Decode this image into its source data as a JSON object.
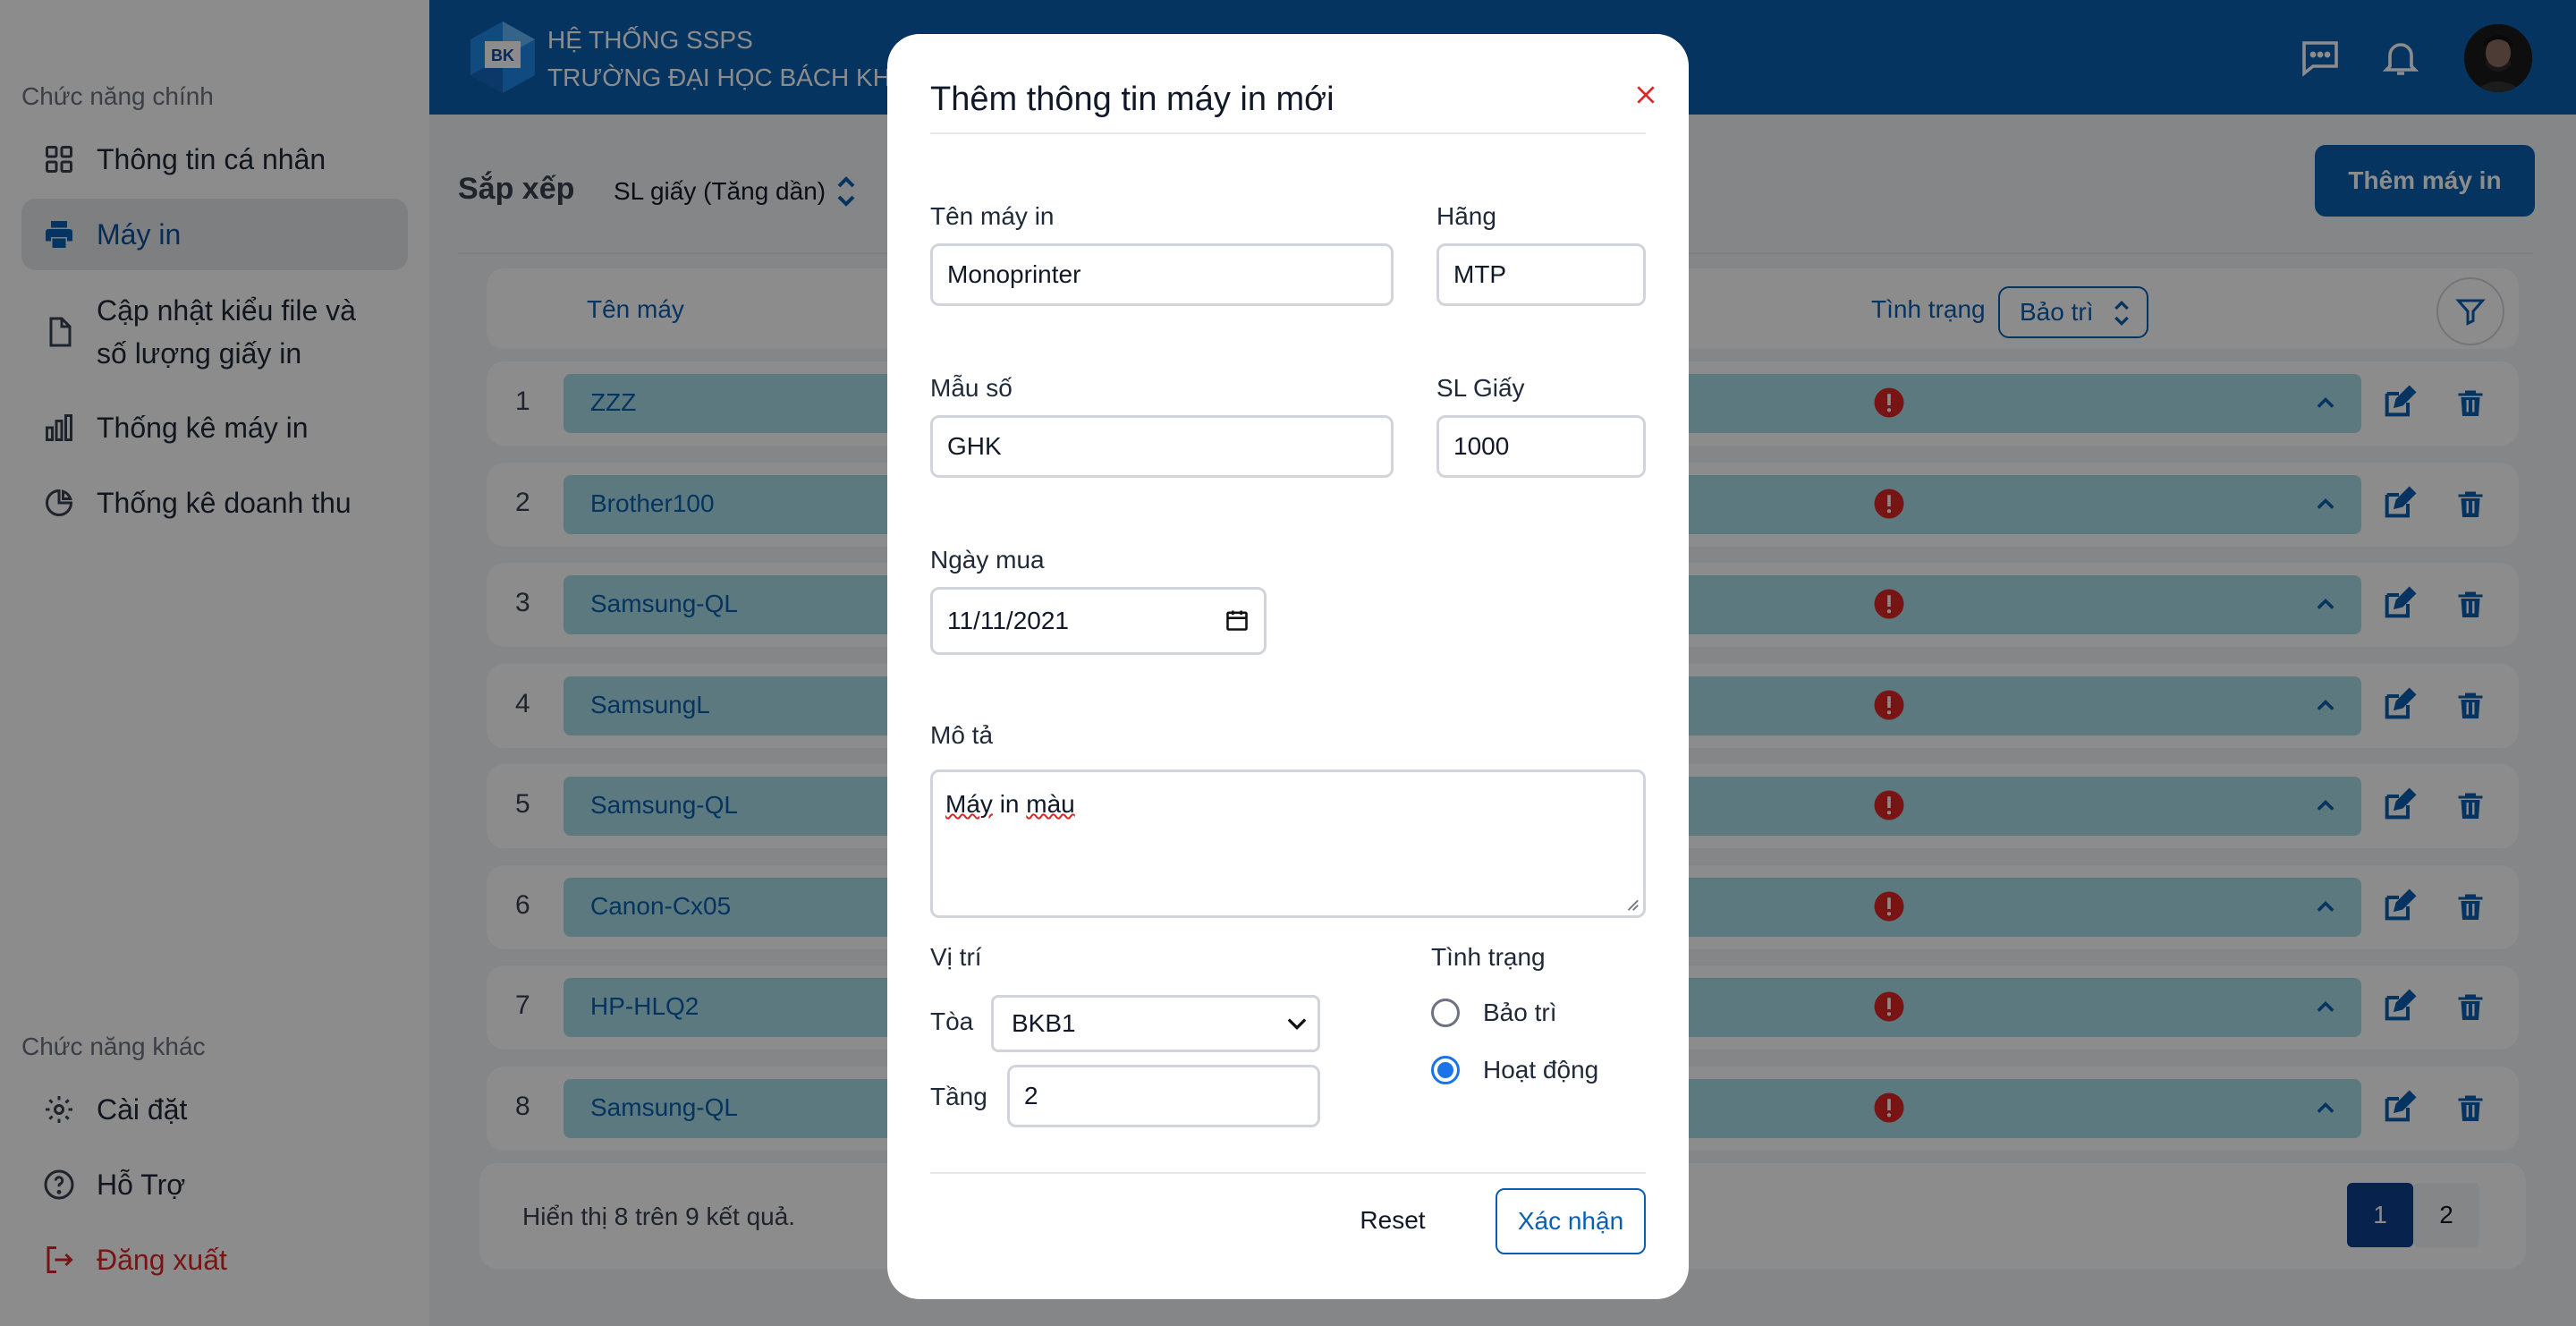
{
  "sidebar": {
    "main_section": "Chức năng chính",
    "items": [
      {
        "label": "Thông tin cá nhân"
      },
      {
        "label": "Máy in"
      },
      {
        "label": "Cập nhật kiểu file và số lượng giấy in"
      },
      {
        "label": "Thống kê máy in"
      },
      {
        "label": "Thống kê doanh thu"
      }
    ],
    "other_section": "Chức năng khác",
    "other_items": [
      {
        "label": "Cài đặt"
      },
      {
        "label": "Hỗ Trợ"
      },
      {
        "label": "Đăng xuất"
      }
    ]
  },
  "header": {
    "logo_text": "BK",
    "title_line1": "HỆ THỐNG SSPS",
    "title_line2": "TRƯỜNG ĐẠI HỌC BÁCH KHOA"
  },
  "toolbar": {
    "sort_label": "Sắp xếp",
    "sort_value": "SL giấy (Tăng dần)",
    "add_button": "Thêm máy in"
  },
  "table": {
    "col_name": "Tên máy",
    "col_status": "Tình trạng",
    "status_filter": "Bảo trì",
    "rows": [
      {
        "index": "1",
        "name": "ZZZ"
      },
      {
        "index": "2",
        "name": "Brother100"
      },
      {
        "index": "3",
        "name": "Samsung-QL"
      },
      {
        "index": "4",
        "name": "SamsungL"
      },
      {
        "index": "5",
        "name": "Samsung-QL"
      },
      {
        "index": "6",
        "name": "Canon-Cx05"
      },
      {
        "index": "7",
        "name": "HP-HLQ2"
      },
      {
        "index": "8",
        "name": "Samsung-QL"
      }
    ],
    "result_text": "Hiển thị 8 trên 9 kết quả.",
    "pages": [
      "1",
      "2"
    ],
    "current_page": "1"
  },
  "modal": {
    "title": "Thêm thông tin máy in mới",
    "name_label": "Tên máy in",
    "name_value": "Monoprinter",
    "brand_label": "Hãng",
    "brand_value": "MTP",
    "model_label": "Mẫu số",
    "model_value": "GHK",
    "paper_label": "SL Giấy",
    "paper_value": "1000",
    "date_label": "Ngày mua",
    "date_value": "11/11/2021",
    "desc_label": "Mô tả",
    "desc_word1": "Máy",
    "desc_word2": "in",
    "desc_word3": "màu",
    "location_label": "Vị trí",
    "building_label": "Tòa",
    "building_value": "BKB1",
    "floor_label": "Tầng",
    "floor_value": "2",
    "status_label": "Tình trạng",
    "status_options": [
      {
        "label": "Bảo trì",
        "checked": false
      },
      {
        "label": "Hoạt động",
        "checked": true
      }
    ],
    "reset_button": "Reset",
    "confirm_button": "Xác nhận"
  },
  "colors": {
    "primary": "#0b5fb0",
    "row_bar": "#a8dce8",
    "warning": "#dc2626",
    "overlay": "rgba(0,0,0,0.45)"
  },
  "icons": [
    "grid-icon",
    "printer-icon",
    "file-icon",
    "bar-chart-icon",
    "pie-chart-icon",
    "gear-icon",
    "help-icon",
    "logout-icon",
    "message-icon",
    "bell-icon",
    "filter-icon",
    "warning-icon",
    "chevron-up-icon",
    "edit-icon",
    "trash-icon",
    "close-icon",
    "calendar-icon"
  ]
}
